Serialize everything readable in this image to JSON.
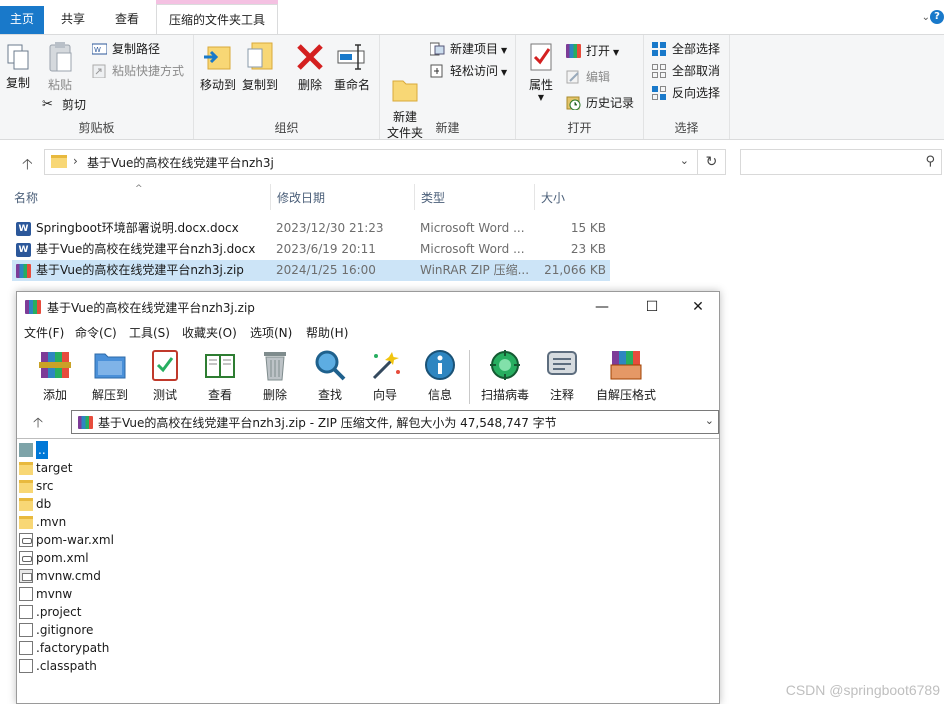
{
  "explorer": {
    "tabs": {
      "file": "主页",
      "share": "共享",
      "view": "查看",
      "tools": "压缩的文件夹工具"
    },
    "ribbon": {
      "clipboard": {
        "label": "剪贴板",
        "copy": "复制",
        "paste": "粘贴",
        "copy_path": "复制路径",
        "paste_shortcut": "粘贴快捷方式",
        "cut": "剪切"
      },
      "organize": {
        "label": "组织",
        "move_to": "移动到",
        "copy_to": "复制到",
        "delete": "删除",
        "rename": "重命名"
      },
      "new": {
        "label": "新建",
        "new_folder": "新建\n文件夹",
        "new_item": "新建项目",
        "easy_access": "轻松访问"
      },
      "open": {
        "label": "打开",
        "properties": "属性",
        "open": "打开",
        "edit": "编辑",
        "history": "历史记录"
      },
      "select": {
        "label": "选择",
        "select_all": "全部选择",
        "select_none": "全部取消",
        "invert": "反向选择"
      }
    },
    "address": {
      "path": "基于Vue的高校在线党建平台nzh3j",
      "search_placeholder": ""
    },
    "columns": {
      "name": "名称",
      "date": "修改日期",
      "type": "类型",
      "size": "大小"
    },
    "files": [
      {
        "name": "Springboot环境部署说明.docx.docx",
        "date": "2023/12/30 21:23",
        "type": "Microsoft Word ...",
        "size": "15 KB",
        "icon": "word-icon"
      },
      {
        "name": "基于Vue的高校在线党建平台nzh3j.docx",
        "date": "2023/6/19 20:11",
        "type": "Microsoft Word ...",
        "size": "23 KB",
        "icon": "word-icon"
      },
      {
        "name": "基于Vue的高校在线党建平台nzh3j.zip",
        "date": "2024/1/25 16:00",
        "type": "WinRAR ZIP 压缩...",
        "size": "21,066 KB",
        "icon": "winrar-icon",
        "selected": true
      }
    ]
  },
  "winrar": {
    "title": "基于Vue的高校在线党建平台nzh3j.zip",
    "menu": [
      "文件(F)",
      "命令(C)",
      "工具(S)",
      "收藏夹(O)",
      "选项(N)",
      "帮助(H)"
    ],
    "toolbar": [
      "添加",
      "解压到",
      "测试",
      "查看",
      "删除",
      "查找",
      "向导",
      "信息",
      "扫描病毒",
      "注释",
      "自解压格式"
    ],
    "path": "基于Vue的高校在线党建平台nzh3j.zip - ZIP 压缩文件, 解包大小为 47,548,747 字节",
    "items": [
      {
        "name": "..",
        "kind": "up"
      },
      {
        "name": "target",
        "kind": "folder"
      },
      {
        "name": "src",
        "kind": "folder"
      },
      {
        "name": "db",
        "kind": "folder"
      },
      {
        "name": ".mvn",
        "kind": "folder"
      },
      {
        "name": "pom-war.xml",
        "kind": "xml"
      },
      {
        "name": "pom.xml",
        "kind": "xml"
      },
      {
        "name": "mvnw.cmd",
        "kind": "cmd"
      },
      {
        "name": "mvnw",
        "kind": "file"
      },
      {
        "name": ".project",
        "kind": "file"
      },
      {
        "name": ".gitignore",
        "kind": "file"
      },
      {
        "name": ".factorypath",
        "kind": "file"
      },
      {
        "name": ".classpath",
        "kind": "file"
      }
    ]
  },
  "watermark": "CSDN @springboot6789"
}
